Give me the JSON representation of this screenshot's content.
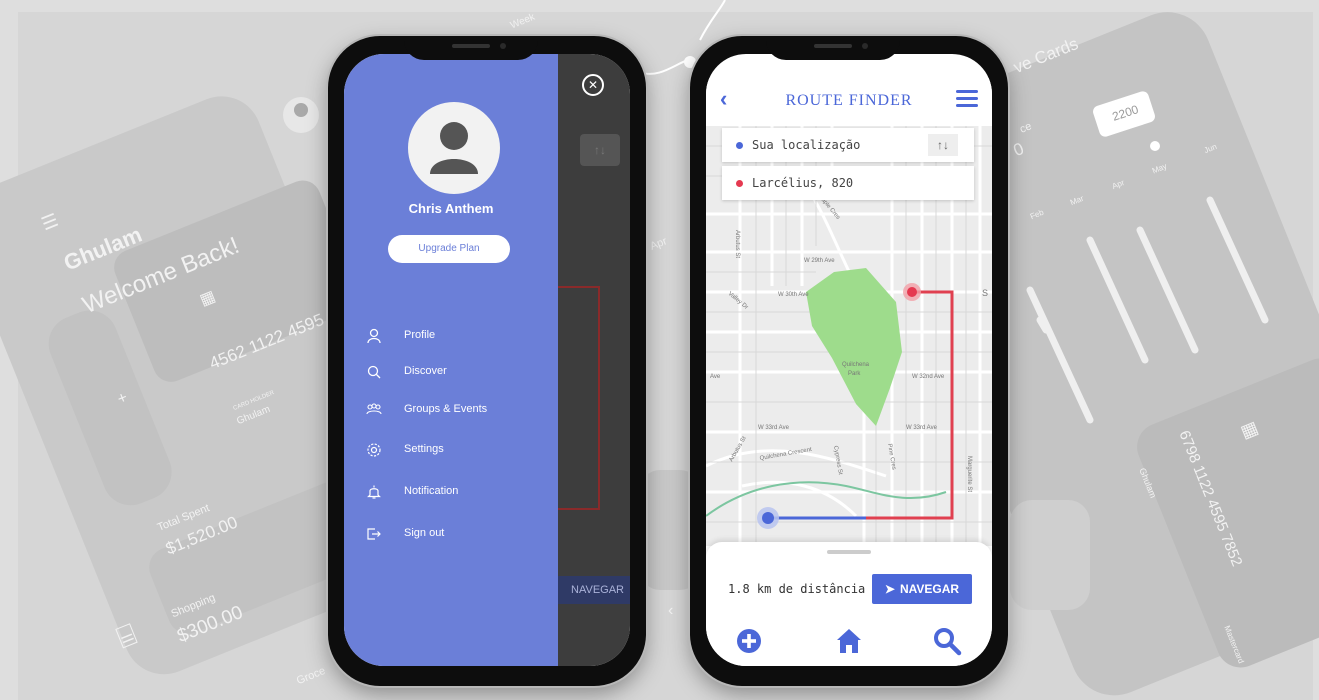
{
  "background": {
    "left_card": {
      "name": "Ghulam",
      "greeting": "Welcome Back!",
      "card_number": "4562 1122 4595",
      "card_holder_label": "CARD HOLDER",
      "card_holder": "Ghulam",
      "total_spent_label": "Total Spent",
      "total_spent": "$1,520.00",
      "shopping_label": "Shopping",
      "shopping_value": "$300.00",
      "grocery_label": "Groce"
    },
    "top_label": "Week",
    "month_label": "Apr",
    "right_card": {
      "title": "ve Cards",
      "balance_label": "ce",
      "balance_value": "0",
      "bubble_value": "2200",
      "months": [
        "Feb",
        "Mar",
        "Apr",
        "May",
        "Jun"
      ],
      "card_number": "6798 1122 4595 7852",
      "card_holder": "Ghulam",
      "brand": "Mastercard"
    }
  },
  "drawer": {
    "user_name": "Chris Anthem",
    "upgrade_label": "Upgrade Plan",
    "menu": [
      {
        "label": "Profile",
        "icon": "person-icon"
      },
      {
        "label": "Discover",
        "icon": "search-icon"
      },
      {
        "label": "Groups & Events",
        "icon": "group-icon"
      },
      {
        "label": "Settings",
        "icon": "gear-icon"
      },
      {
        "label": "Notification",
        "icon": "bell-icon"
      },
      {
        "label": "Sign out",
        "icon": "sign-out-icon"
      }
    ],
    "behind_nav_label": "NAVEGAR",
    "behind_swap": "↑↓"
  },
  "route_finder": {
    "title": "ROUTE FINDER",
    "back_glyph": "‹",
    "origin": "Sua localização",
    "destination": "Larcélius, 820",
    "swap_glyph": "↑↓",
    "distance": "1.8 km de distância",
    "navigate_label": "NAVEGAR",
    "colors": {
      "accent": "#4b67d8",
      "origin_dot": "#4b67d8",
      "destination_dot": "#e53950",
      "park": "#9edc8c"
    },
    "map": {
      "park_name_1": "Quilchena",
      "park_name_2": "Park",
      "streets": {
        "w33rd_left": "W 33rd Ave",
        "w33rd_right": "W 33rd Ave",
        "w32nd": "W 32nd Ave",
        "w30th": "W 30th Ave",
        "w29th": "W 29th Ave",
        "arbutus": "Arbutus St",
        "maple": "Maple Cres",
        "valley": "Valley Dr",
        "quilchena_cres": "Quilchena Crescent",
        "cypress": "Cypress St",
        "pine": "Pine Cres",
        "marguerite": "Marguerite St",
        "ave": "Ave",
        "s": "S"
      }
    }
  }
}
